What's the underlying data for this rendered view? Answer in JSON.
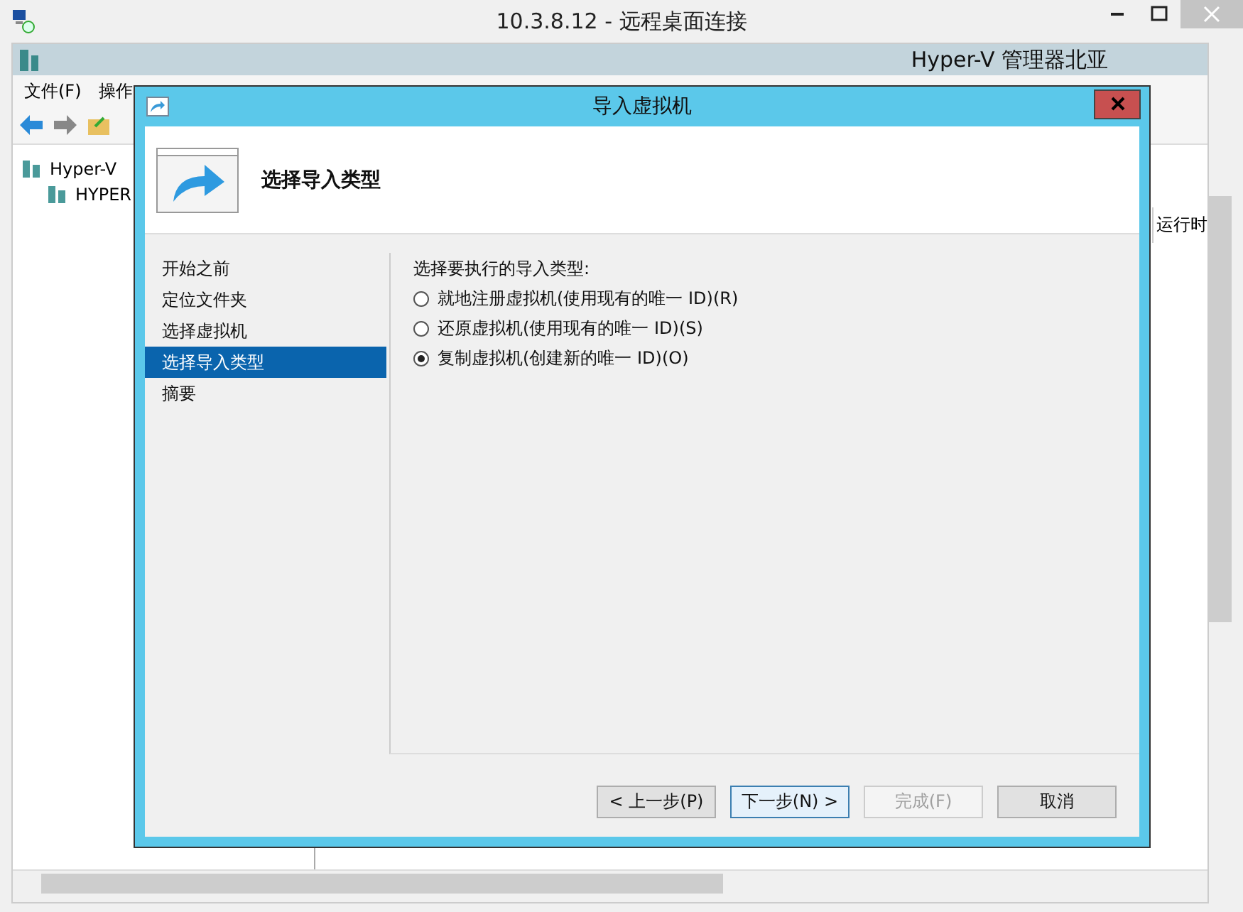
{
  "window": {
    "title": "10.3.8.12 - 远程桌面连接"
  },
  "app": {
    "title": "Hyper-V 管理器北亚",
    "menu": [
      "文件(F)",
      "操作"
    ],
    "tree": [
      {
        "label": "Hyper-V",
        "children": [
          {
            "label": "HYPER"
          }
        ]
      }
    ],
    "column_label": "运行时"
  },
  "dialog": {
    "title": "导入虚拟机",
    "heading": "选择导入类型",
    "steps": [
      {
        "label": "开始之前",
        "selected": false
      },
      {
        "label": "定位文件夹",
        "selected": false
      },
      {
        "label": "选择虚拟机",
        "selected": false
      },
      {
        "label": "选择导入类型",
        "selected": true
      },
      {
        "label": "摘要",
        "selected": false
      }
    ],
    "prompt": "选择要执行的导入类型:",
    "options": [
      {
        "label": "就地注册虚拟机(使用现有的唯一 ID)(R)",
        "selected": false
      },
      {
        "label": "还原虚拟机(使用现有的唯一 ID)(S)",
        "selected": false
      },
      {
        "label": "复制虚拟机(创建新的唯一 ID)(O)",
        "selected": true
      }
    ],
    "buttons": [
      {
        "label": "< 上一步(P)",
        "disabled": false,
        "selected": false
      },
      {
        "label": "下一步(N) >",
        "disabled": false,
        "selected": true
      },
      {
        "label": "完成(F)",
        "disabled": true,
        "selected": false
      },
      {
        "label": "取消",
        "disabled": false,
        "selected": false
      }
    ]
  }
}
